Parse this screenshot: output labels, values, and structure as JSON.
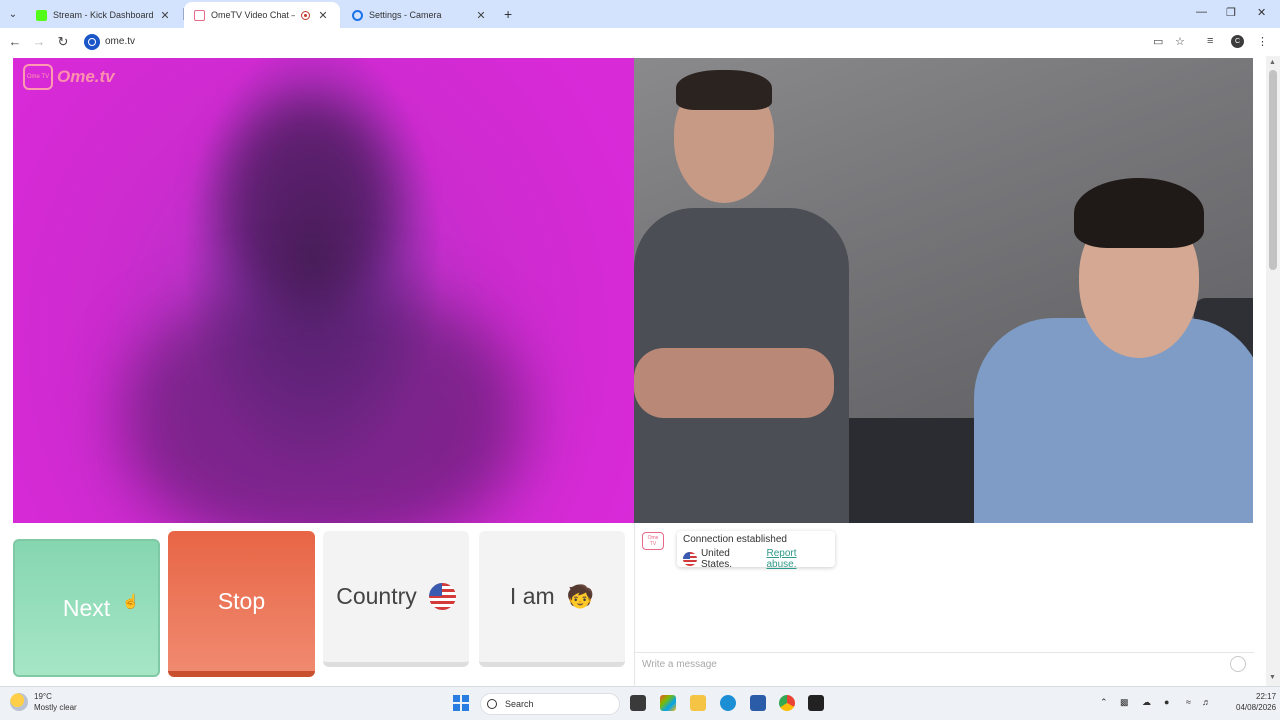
{
  "browser": {
    "tabs": [
      {
        "title": "Stream - Kick Dashboard",
        "favicon_color": "#53fc18",
        "active": false
      },
      {
        "title": "OmeTV Video Chat — Ome",
        "favicon_color": "#e96a88",
        "active": true,
        "recording": true
      },
      {
        "title": "Settings - Camera",
        "favicon_color": "#1a73e8",
        "active": false
      }
    ],
    "url": "ome.tv",
    "profile_initial": "C"
  },
  "site": {
    "logo_text": "Ome.tv",
    "logo_badge": "Ome TV"
  },
  "controls": {
    "next_label": "Next",
    "stop_label": "Stop",
    "country_label": "Country",
    "country_flag": "us-flag-icon",
    "iam_label": "I am",
    "iam_icon": "🧒"
  },
  "chat": {
    "status_text": "Connection established",
    "country_text": "United States.",
    "report_link": "Report abuse.",
    "input_placeholder": "Write a message"
  },
  "taskbar": {
    "weather_temp": "19°C",
    "weather_desc": "Mostly clear",
    "search_label": "Search",
    "time": "22:17",
    "date": "04/08/2026"
  },
  "colors": {
    "next": "#86d6b1",
    "stop": "#e86546",
    "link": "#2f9a8a",
    "tabstrip": "#d3e3fd"
  }
}
